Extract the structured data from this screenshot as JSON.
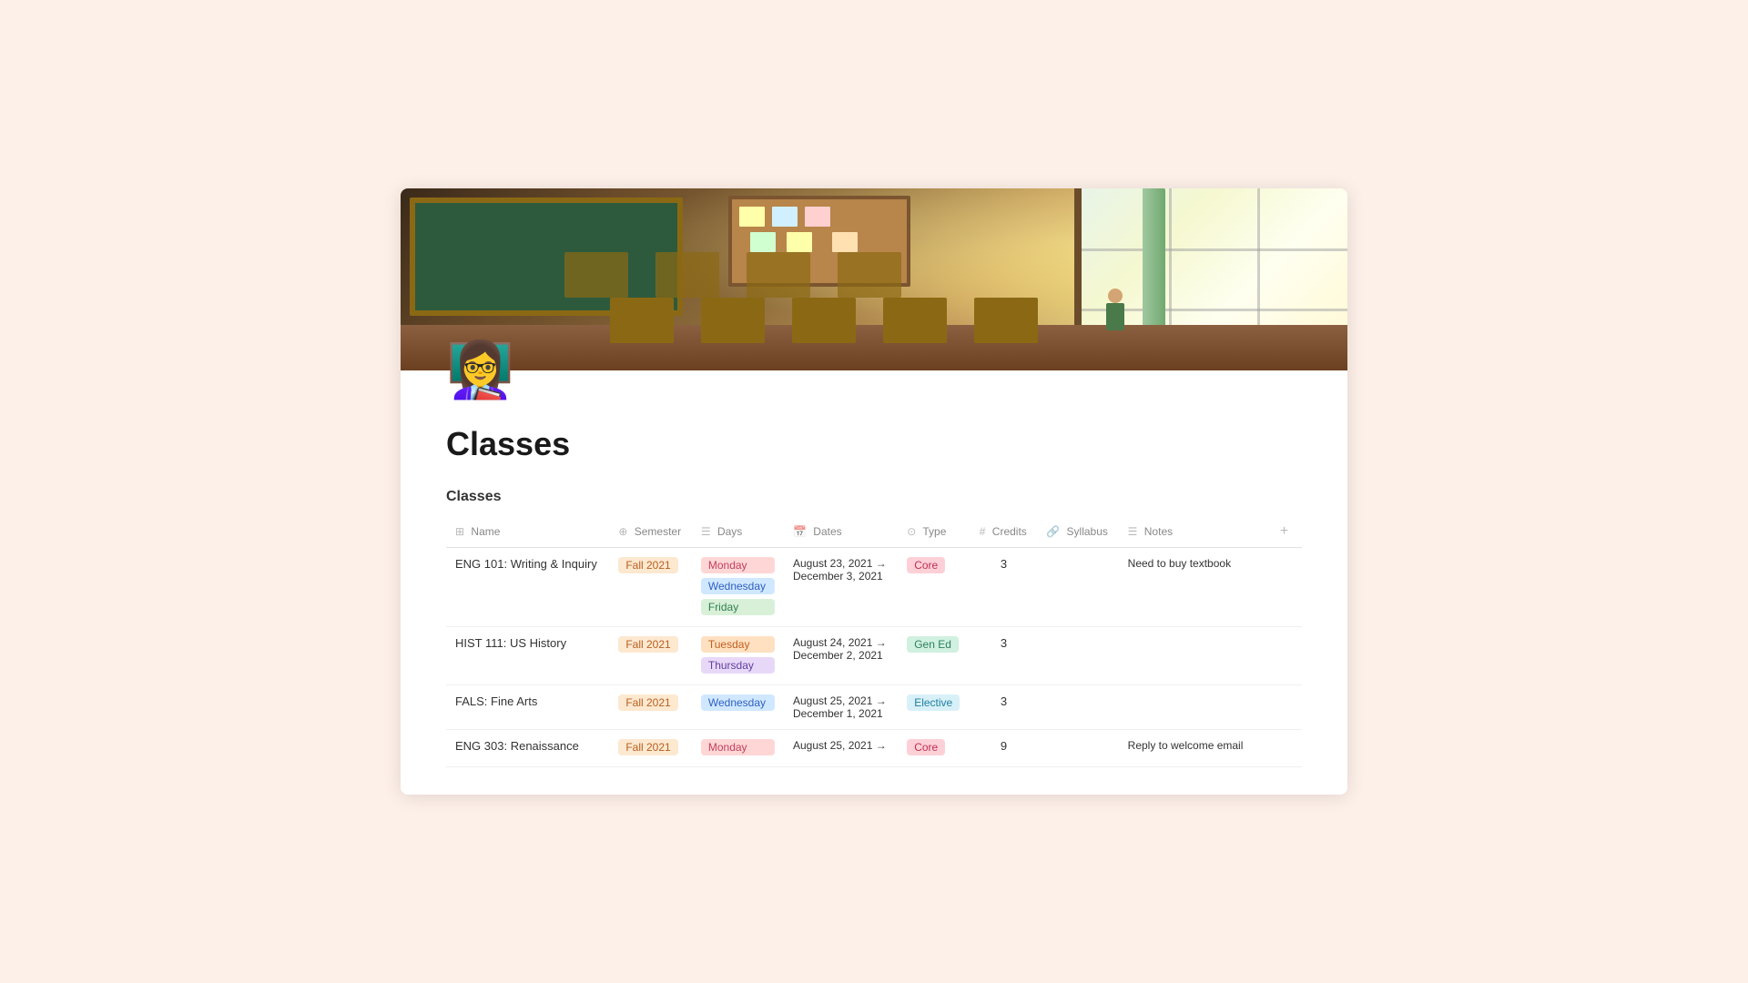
{
  "page": {
    "icon": "👩‍🏫",
    "title": "Classes",
    "section": "Classes"
  },
  "table": {
    "columns": [
      {
        "id": "name",
        "label": "Name",
        "icon": "⊞"
      },
      {
        "id": "semester",
        "label": "Semester",
        "icon": "⊕"
      },
      {
        "id": "days",
        "label": "Days",
        "icon": "☰"
      },
      {
        "id": "dates",
        "label": "Dates",
        "icon": "📅"
      },
      {
        "id": "type",
        "label": "Type",
        "icon": "⊙"
      },
      {
        "id": "credits",
        "label": "Credits",
        "icon": "#"
      },
      {
        "id": "syllabus",
        "label": "Syllabus",
        "icon": "🔗"
      },
      {
        "id": "notes",
        "label": "Notes",
        "icon": "☰"
      }
    ],
    "rows": [
      {
        "name": "ENG 101: Writing & Inquiry",
        "semester": "Fall 2021",
        "days": [
          "Monday",
          "Wednesday",
          "Friday"
        ],
        "day_types": [
          "monday",
          "wednesday",
          "friday"
        ],
        "dates_start": "August 23, 2021 →",
        "dates_end": "December 3, 2021",
        "type": "Core",
        "type_style": "core",
        "credits": "3",
        "syllabus": "",
        "notes": "Need to buy textbook"
      },
      {
        "name": "HIST 111: US History",
        "semester": "Fall 2021",
        "days": [
          "Tuesday",
          "Thursday"
        ],
        "day_types": [
          "tuesday",
          "thursday"
        ],
        "dates_start": "August 24, 2021 →",
        "dates_end": "December 2, 2021",
        "type": "Gen Ed",
        "type_style": "gened",
        "credits": "3",
        "syllabus": "",
        "notes": ""
      },
      {
        "name": "FALS: Fine Arts",
        "semester": "Fall 2021",
        "days": [
          "Wednesday"
        ],
        "day_types": [
          "wednesday"
        ],
        "dates_start": "August 25, 2021 →",
        "dates_end": "December 1, 2021",
        "type": "Elective",
        "type_style": "elective",
        "credits": "3",
        "syllabus": "",
        "notes": ""
      },
      {
        "name": "ENG 303: Renaissance",
        "semester": "Fall 2021",
        "days": [
          "Monday"
        ],
        "day_types": [
          "monday"
        ],
        "dates_start": "August 25, 2021 →",
        "dates_end": "",
        "type": "Core",
        "type_style": "core",
        "credits": "9",
        "syllabus": "",
        "notes": "Reply to welcome email"
      }
    ],
    "add_button": "+"
  }
}
